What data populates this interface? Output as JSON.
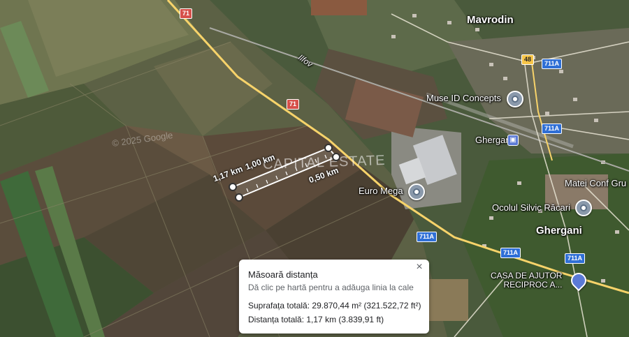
{
  "map": {
    "places": {
      "mavrodin": "Mavrodin",
      "ghergani_town": "Ghergani",
      "ghergani_station": "Ghergani",
      "matei_conf": "Matei Conf Gru",
      "ocolul": "Ocolul Silvic Răcari",
      "muse": "Muse ID Concepts",
      "euro_mega": "Euro Mega",
      "casa_line1": "CASA DE AJUTOR",
      "casa_line2": "RECIPROC A..."
    },
    "railway_label": "Ilfov",
    "road_shields": {
      "r71_top": "71",
      "r71_mid": "71",
      "r48": "48",
      "r711a_1": "711A",
      "r711a_2": "711A",
      "r711a_3": "711A",
      "r711a_4": "711A",
      "r711a_5": "711A"
    },
    "watermark": "CAPITAL ESTATE",
    "copyright": "© 2025 Google",
    "colors": {
      "road_primary": "#f7d36a",
      "shield_red": "#d6504a",
      "shield_blue": "#2f6fd6",
      "shield_yellow": "#f7c548",
      "measure_line": "#ffffff"
    },
    "icons": {
      "poi_pin": "place-pin-icon",
      "casa_pin": "building-pin-icon",
      "station": "train-station-icon",
      "close": "close-icon"
    }
  },
  "measurement": {
    "segment_labels": {
      "total": "1,17 km",
      "long_side": "1,00 km",
      "short_side": "0,50 km"
    }
  },
  "panel": {
    "title": "Măsoară distanța",
    "hint": "Dă clic pe hartă pentru a adăuga linia la cale",
    "area": "Suprafața totală: 29.870,44 m² (321.522,72 ft²)",
    "distance": "Distanța totală: 1,17 km (3.839,91 ft)",
    "close_label": "×"
  }
}
